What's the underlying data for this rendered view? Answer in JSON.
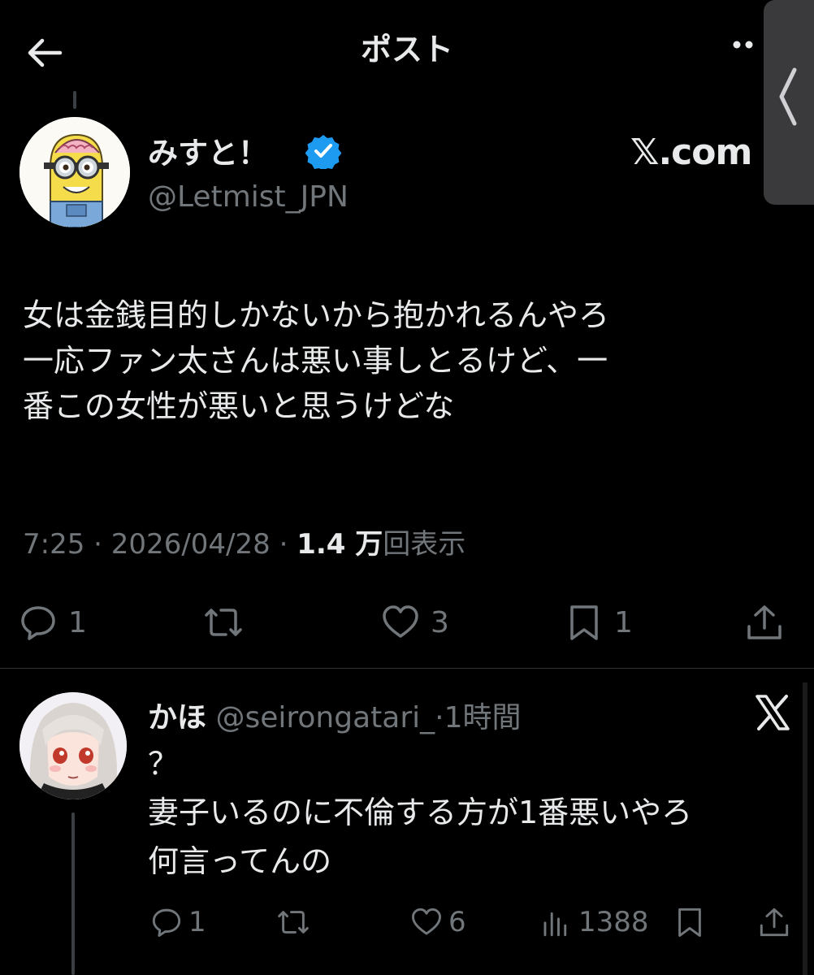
{
  "header": {
    "title": "ポスト"
  },
  "post": {
    "display_name": "みすと！",
    "handle": "@Letmist_JPN",
    "source_badge": "𝕏.com",
    "body_lines": [
      "女は金銭目的しかないから抱かれるんやろ",
      "一応ファン太さんは悪い事しとるけど、一",
      "番この女性が悪いと思うけどな"
    ],
    "time": "7:25",
    "date": "2026/04/28",
    "views_value": "1.4 万",
    "views_label": "回表示",
    "actions": {
      "reply_count": "1",
      "retweet_count": "",
      "like_count": "3",
      "bookmark_count": "1"
    }
  },
  "reply": {
    "display_name": "かほ",
    "handle": "@seirongatari_",
    "time_ago": "1時間",
    "body_lines": [
      "？",
      "妻子いるのに不倫する方が1番悪いやろ",
      "何言ってんの"
    ],
    "actions": {
      "reply_count": "1",
      "like_count": "6",
      "views_count": "1388"
    }
  },
  "colors": {
    "background": "#000000",
    "text": "#e7e9ea",
    "muted": "#71767b",
    "verified": "#1d9bf0"
  }
}
